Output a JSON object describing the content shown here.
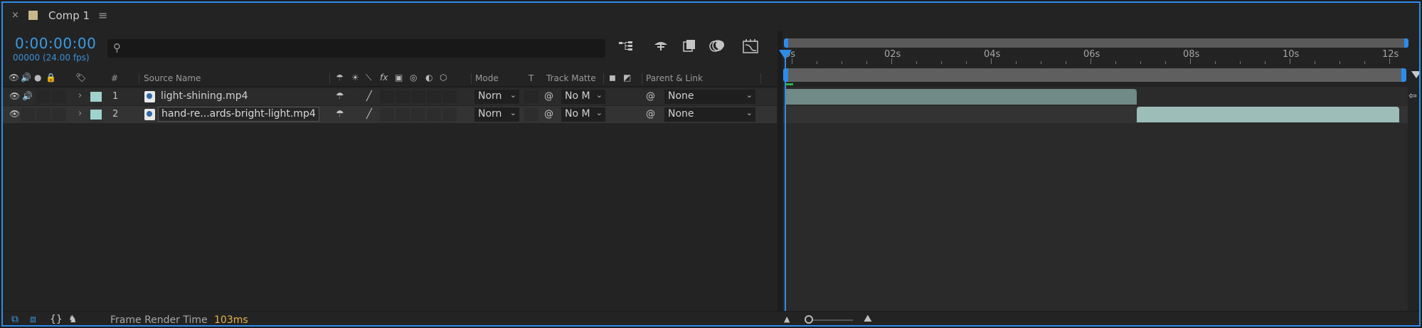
{
  "tab": {
    "close": "×",
    "title": "Comp 1",
    "menu": "≡",
    "swatch_color": "#c7b98a"
  },
  "time": {
    "timecode": "0:00:00:00",
    "frames": "00000 (24.00 fps)"
  },
  "search": {
    "placeholder": "",
    "icon": "search-icon"
  },
  "toolbar": {
    "icons": [
      "composition-mini-flowchart-icon",
      "draft-3d-icon",
      "frame-blending-icon",
      "motion-blur-icon",
      "graph-editor-icon"
    ]
  },
  "columns": {
    "index": "#",
    "source_name": "Source Name",
    "mode": "Mode",
    "t": "T",
    "track_matte": "Track Matte",
    "parent_link": "Parent & Link"
  },
  "layers": [
    {
      "index": "1",
      "name": "light-shining.mp4",
      "mode": "Norn",
      "matte": "No M",
      "parent": "None",
      "label_color": "#9fd2cd"
    },
    {
      "index": "2",
      "name": "hand-re...ards-bright-light.mp4",
      "mode": "Norn",
      "matte": "No M",
      "parent": "None",
      "label_color": "#9fd2cd"
    }
  ],
  "ruler": {
    "labels": [
      "0s",
      "02s",
      "04s",
      "06s",
      "08s",
      "10s",
      "12s"
    ]
  },
  "layer_bars": [
    {
      "start_s": 0,
      "end_s": 7.05,
      "color": "#6f8a87"
    },
    {
      "start_s": 7.05,
      "end_s": 12.4,
      "color": "#9dbdb9"
    }
  ],
  "footer": {
    "label": "Frame Render Time",
    "value": "103ms"
  },
  "accent_color": "#2d8ceb"
}
